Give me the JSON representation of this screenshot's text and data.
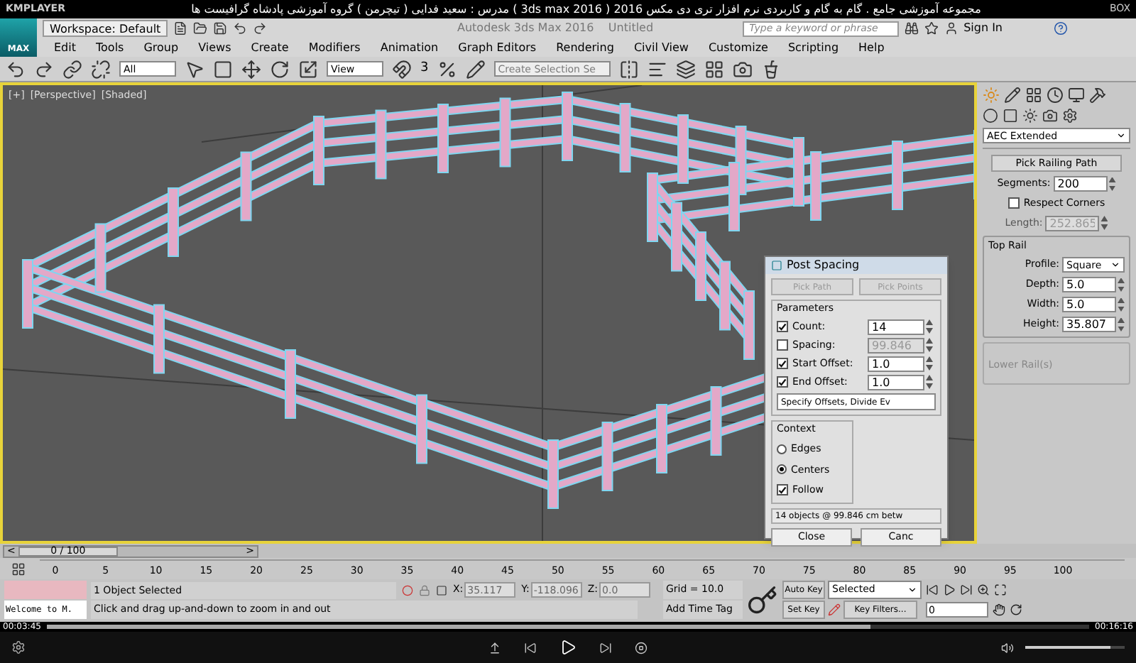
{
  "player": {
    "app_name": "KMPLAYER",
    "title": "مجموعه آموزشی جامع . گام به گام و کاربردی نرم افزار تری دی مکس 2016 ( 3ds max 2016 ) مدرس : سعید فدایی ( تیچرمن ) گروه آموزشی پادشاه گرافیست ها",
    "corner_label": "BOX",
    "elapsed": "00:03:45",
    "total": "00:16:16",
    "progress": {
      "level": 0.79
    },
    "volume": {
      "level": 0.85
    }
  },
  "max": {
    "logo": "MAX",
    "workspace": "Workspace: Default",
    "title": "Autodesk 3ds Max 2016    Untitled",
    "search_placeholder": "Type a keyword or phrase",
    "sign_in": "Sign In"
  },
  "menu": [
    "Edit",
    "Tools",
    "Group",
    "Views",
    "Create",
    "Modifiers",
    "Animation",
    "Graph Editors",
    "Rendering",
    "Civil View",
    "Customize",
    "Scripting",
    "Help"
  ],
  "toolbar": {
    "selection_filter": "All",
    "reference_coord": "View",
    "snap_label": "3",
    "named_selection_placeholder": "Create Selection Se"
  },
  "viewport": {
    "labels": [
      "[+]",
      "[Perspective]",
      "[Shaded]"
    ]
  },
  "command_panel": {
    "category": "AEC Extended",
    "pick_button": "Pick Railing Path",
    "segments": {
      "label": "Segments:",
      "value": "200"
    },
    "respect_corners": {
      "label": "Respect Corners",
      "checked": false
    },
    "length": {
      "label": "Length:",
      "value": "252.865",
      "disabled": true
    },
    "top_rail": {
      "title": "Top Rail",
      "fields": [
        {
          "kind": "dropdown",
          "label": "Profile:",
          "value": "Square"
        },
        {
          "kind": "spinner",
          "label": "Depth:",
          "value": "5.0"
        },
        {
          "kind": "spinner",
          "label": "Width:",
          "value": "5.0"
        },
        {
          "kind": "spinner",
          "label": "Height:",
          "value": "35.807"
        }
      ]
    },
    "lower_rails": {
      "title": "Lower Rail(s)",
      "disabled": true
    }
  },
  "dialog": {
    "title": "Post Spacing",
    "top_buttons": [
      {
        "label": "Pick Path",
        "disabled": true
      },
      {
        "label": "Pick Points",
        "disabled": true
      }
    ],
    "parameters_title": "Parameters",
    "params": [
      {
        "label": "Count:",
        "checked": true,
        "value": "14",
        "disabled": false
      },
      {
        "label": "Spacing:",
        "checked": false,
        "value": "99.846",
        "disabled": true
      },
      {
        "label": "Start Offset:",
        "checked": true,
        "value": "1.0",
        "disabled": false
      },
      {
        "label": "End Offset:",
        "checked": true,
        "value": "1.0",
        "disabled": false
      }
    ],
    "mode": "Specify Offsets, Divide Ev",
    "context_title": "Context",
    "context": [
      {
        "label": "Edges",
        "selected": false
      },
      {
        "label": "Centers",
        "selected": true
      }
    ],
    "follow": {
      "label": "Follow",
      "checked": true
    },
    "summary": "14 objects @ 99.846 cm betw",
    "bottom_buttons": [
      "Close",
      "Canc"
    ]
  },
  "timeline": {
    "prev": "<",
    "counter": "0 / 100",
    "next": ">",
    "ticks": [
      "0",
      "5",
      "10",
      "15",
      "20",
      "25",
      "30",
      "35",
      "40",
      "45",
      "50",
      "55",
      "60",
      "65",
      "70",
      "75",
      "80",
      "85",
      "90",
      "95",
      "100"
    ]
  },
  "status": {
    "listener": "Welcome to M.",
    "selection": "1 Object Selected",
    "prompt": "Click and drag up-and-down to zoom in and out",
    "coords": [
      {
        "label": "X:",
        "value": "35.117"
      },
      {
        "label": "Y:",
        "value": "-118.096"
      },
      {
        "label": "Z:",
        "value": "0.0"
      }
    ],
    "grid": "Grid = 10.0",
    "time_tag": "Add Time Tag",
    "auto_key": "Auto Key",
    "key_mode": "Selected",
    "set_key": "Set Key",
    "key_filters": "Key Filters...",
    "frame": "0"
  }
}
